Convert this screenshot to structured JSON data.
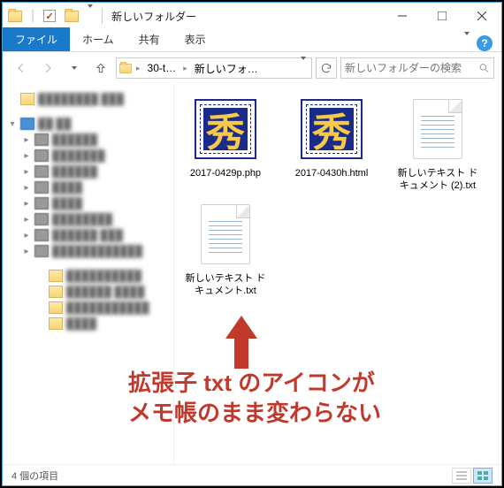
{
  "titlebar": {
    "title": "新しいフォルダー"
  },
  "tabs": {
    "file": "ファイル",
    "home": "ホーム",
    "share": "共有",
    "view": "表示"
  },
  "addressbar": {
    "crumb1": "30-t…",
    "crumb2": "新しいフォ…",
    "search_placeholder": "新しいフォルダーの検索"
  },
  "sidebar": {
    "items": [
      {
        "label": "████████ ███",
        "expander": "",
        "indent": 0,
        "ico": "f"
      },
      {
        "label": "",
        "expander": "",
        "indent": 0,
        "ico": ""
      },
      {
        "label": "██ ██",
        "expander": "▾",
        "indent": 0,
        "ico": "pc"
      },
      {
        "label": "██████",
        "expander": "▸",
        "indent": 1,
        "ico": "d"
      },
      {
        "label": "███████",
        "expander": "▸",
        "indent": 1,
        "ico": "d"
      },
      {
        "label": "██████",
        "expander": "▸",
        "indent": 1,
        "ico": "d"
      },
      {
        "label": "████",
        "expander": "▸",
        "indent": 1,
        "ico": "d"
      },
      {
        "label": "████",
        "expander": "▸",
        "indent": 1,
        "ico": "d"
      },
      {
        "label": "████████",
        "expander": "▸",
        "indent": 1,
        "ico": "d"
      },
      {
        "label": "██████ ███",
        "expander": "▸",
        "indent": 1,
        "ico": "d"
      },
      {
        "label": "████████████",
        "expander": "▸",
        "indent": 1,
        "ico": "d"
      },
      {
        "label": "",
        "expander": "",
        "indent": 1,
        "ico": ""
      },
      {
        "label": "██████████",
        "expander": "",
        "indent": 2,
        "ico": "f"
      },
      {
        "label": "██████ ████",
        "expander": "",
        "indent": 2,
        "ico": "f"
      },
      {
        "label": "███████████",
        "expander": "",
        "indent": 2,
        "ico": "f"
      },
      {
        "label": "████",
        "expander": "",
        "indent": 2,
        "ico": "f"
      }
    ]
  },
  "files": [
    {
      "name": "2017-0429p.php",
      "icon": "hidemaru"
    },
    {
      "name": "2017-0430h.html",
      "icon": "hidemaru"
    },
    {
      "name": "新しいテキスト ドキュメント (2).txt",
      "icon": "txt"
    },
    {
      "name": "新しいテキスト ドキュメント.txt",
      "icon": "txt"
    }
  ],
  "annotation": {
    "line1": "拡張子 txt のアイコンが",
    "line2": "メモ帳のまま変わらない"
  },
  "statusbar": {
    "count": "4 個の項目"
  },
  "glyphs": {
    "hidemaru": "秀",
    "help": "?"
  }
}
